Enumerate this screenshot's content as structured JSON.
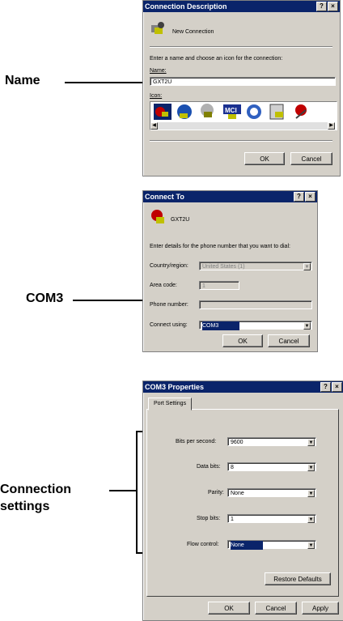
{
  "dialog1": {
    "title": "Connection Description",
    "heading": "New Connection",
    "instructions": "Enter a name and choose an icon for the connection:",
    "name_label": "Name:",
    "name_value": "GXT2U",
    "icon_label": "Icon:",
    "ok": "OK",
    "cancel": "Cancel"
  },
  "dialog2": {
    "title": "Connect To",
    "heading": "GXT2U",
    "instructions": "Enter details for the phone number that you want to dial:",
    "country_label": "Country/region:",
    "country_value": "United States (1)",
    "area_label": "Area code:",
    "area_value": "1",
    "phone_label": "Phone number:",
    "phone_value": "",
    "connect_label": "Connect using:",
    "connect_value": "COM3",
    "ok": "OK",
    "cancel": "Cancel"
  },
  "dialog3": {
    "title": "COM3 Properties",
    "tab": "Port Settings",
    "bits_label": "Bits per second:",
    "bits_value": "9600",
    "data_label": "Data bits:",
    "data_value": "8",
    "parity_label": "Parity:",
    "parity_value": "None",
    "stop_label": "Stop bits:",
    "stop_value": "1",
    "flow_label": "Flow control:",
    "flow_value": "None",
    "restore": "Restore Defaults",
    "ok": "OK",
    "cancel": "Cancel",
    "apply": "Apply"
  },
  "callouts": {
    "name": "Name",
    "com3": "COM3",
    "connection_line1": "Connection",
    "connection_line2": "settings"
  },
  "titlebar_buttons": {
    "help": "?",
    "close": "×"
  }
}
